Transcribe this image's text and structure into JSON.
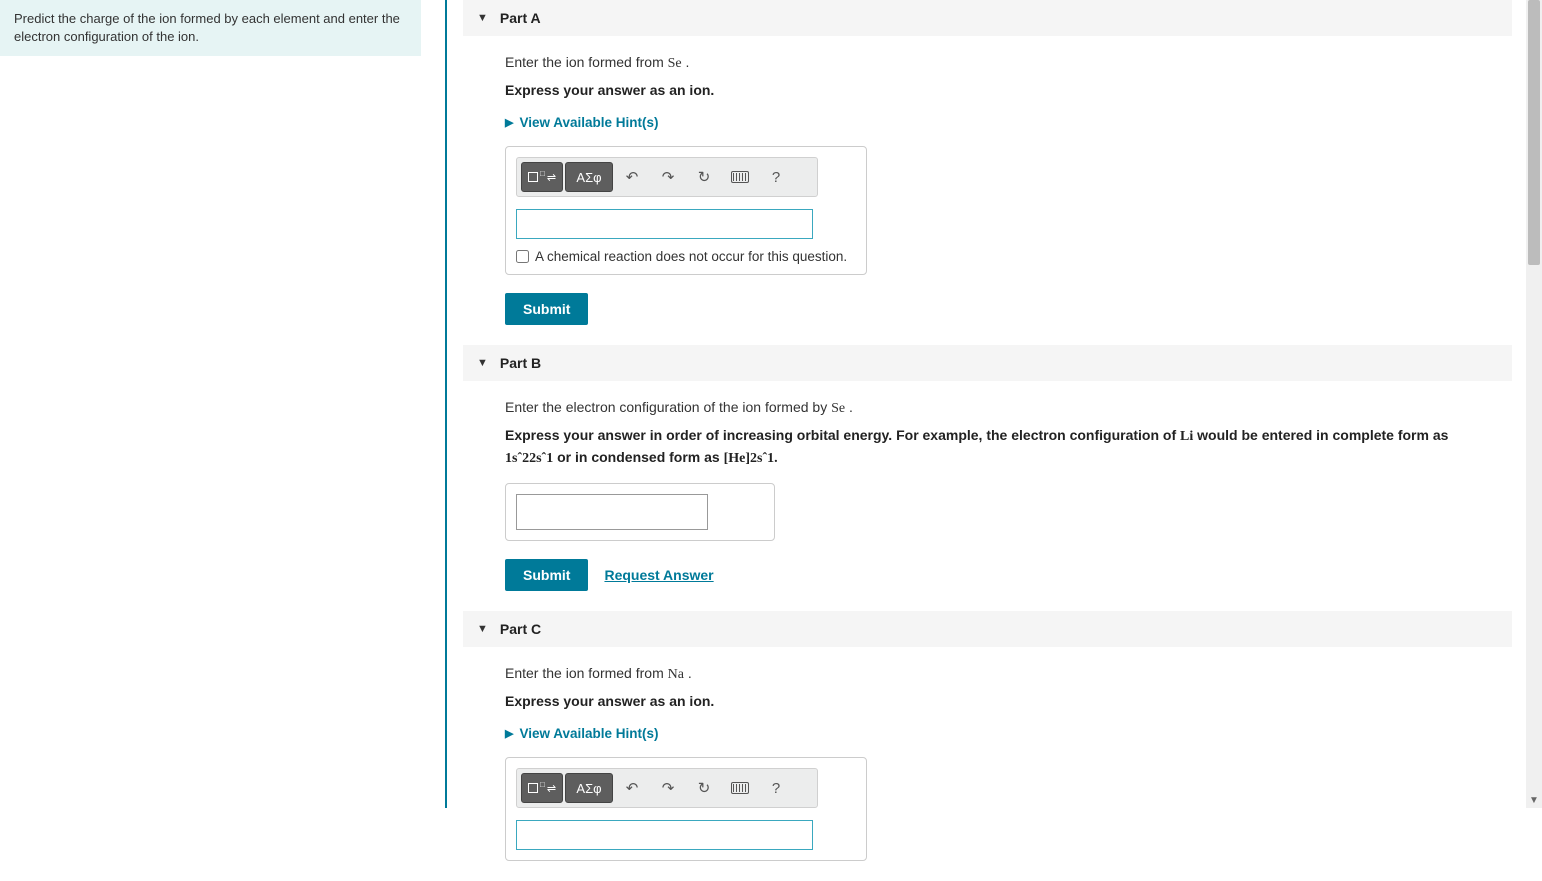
{
  "left_panel": {
    "instruction": "Predict the charge of the ion formed by each element and enter the electron configuration of the ion."
  },
  "parts": {
    "a": {
      "header": "Part A",
      "prompt_pre": "Enter the ion formed from ",
      "prompt_elem": "Se",
      "prompt_post": " .",
      "express": "Express your answer as an ion.",
      "hints": "View Available Hint(s)",
      "greek_label": "ΑΣφ",
      "checkbox_label": "A chemical reaction does not occur for this question.",
      "submit": "Submit"
    },
    "b": {
      "header": "Part B",
      "prompt_pre": "Enter the electron configuration of the ion formed by ",
      "prompt_elem": "Se",
      "prompt_post": " .",
      "express_pre": "Express your answer in order of increasing orbital energy. For example, the electron configuration of ",
      "express_li": "Li",
      "express_mid": " would be entered in complete form as ",
      "express_cfg1": "1sˆ22sˆ1",
      "express_mid2": " or in condensed form as ",
      "express_cfg2": "[He]2sˆ1.",
      "submit": "Submit",
      "request": "Request Answer"
    },
    "c": {
      "header": "Part C",
      "prompt_pre": "Enter the ion formed from ",
      "prompt_elem": "Na",
      "prompt_post": " .",
      "express": "Express your answer as an ion.",
      "hints": "View Available Hint(s)",
      "greek_label": "ΑΣφ"
    }
  }
}
